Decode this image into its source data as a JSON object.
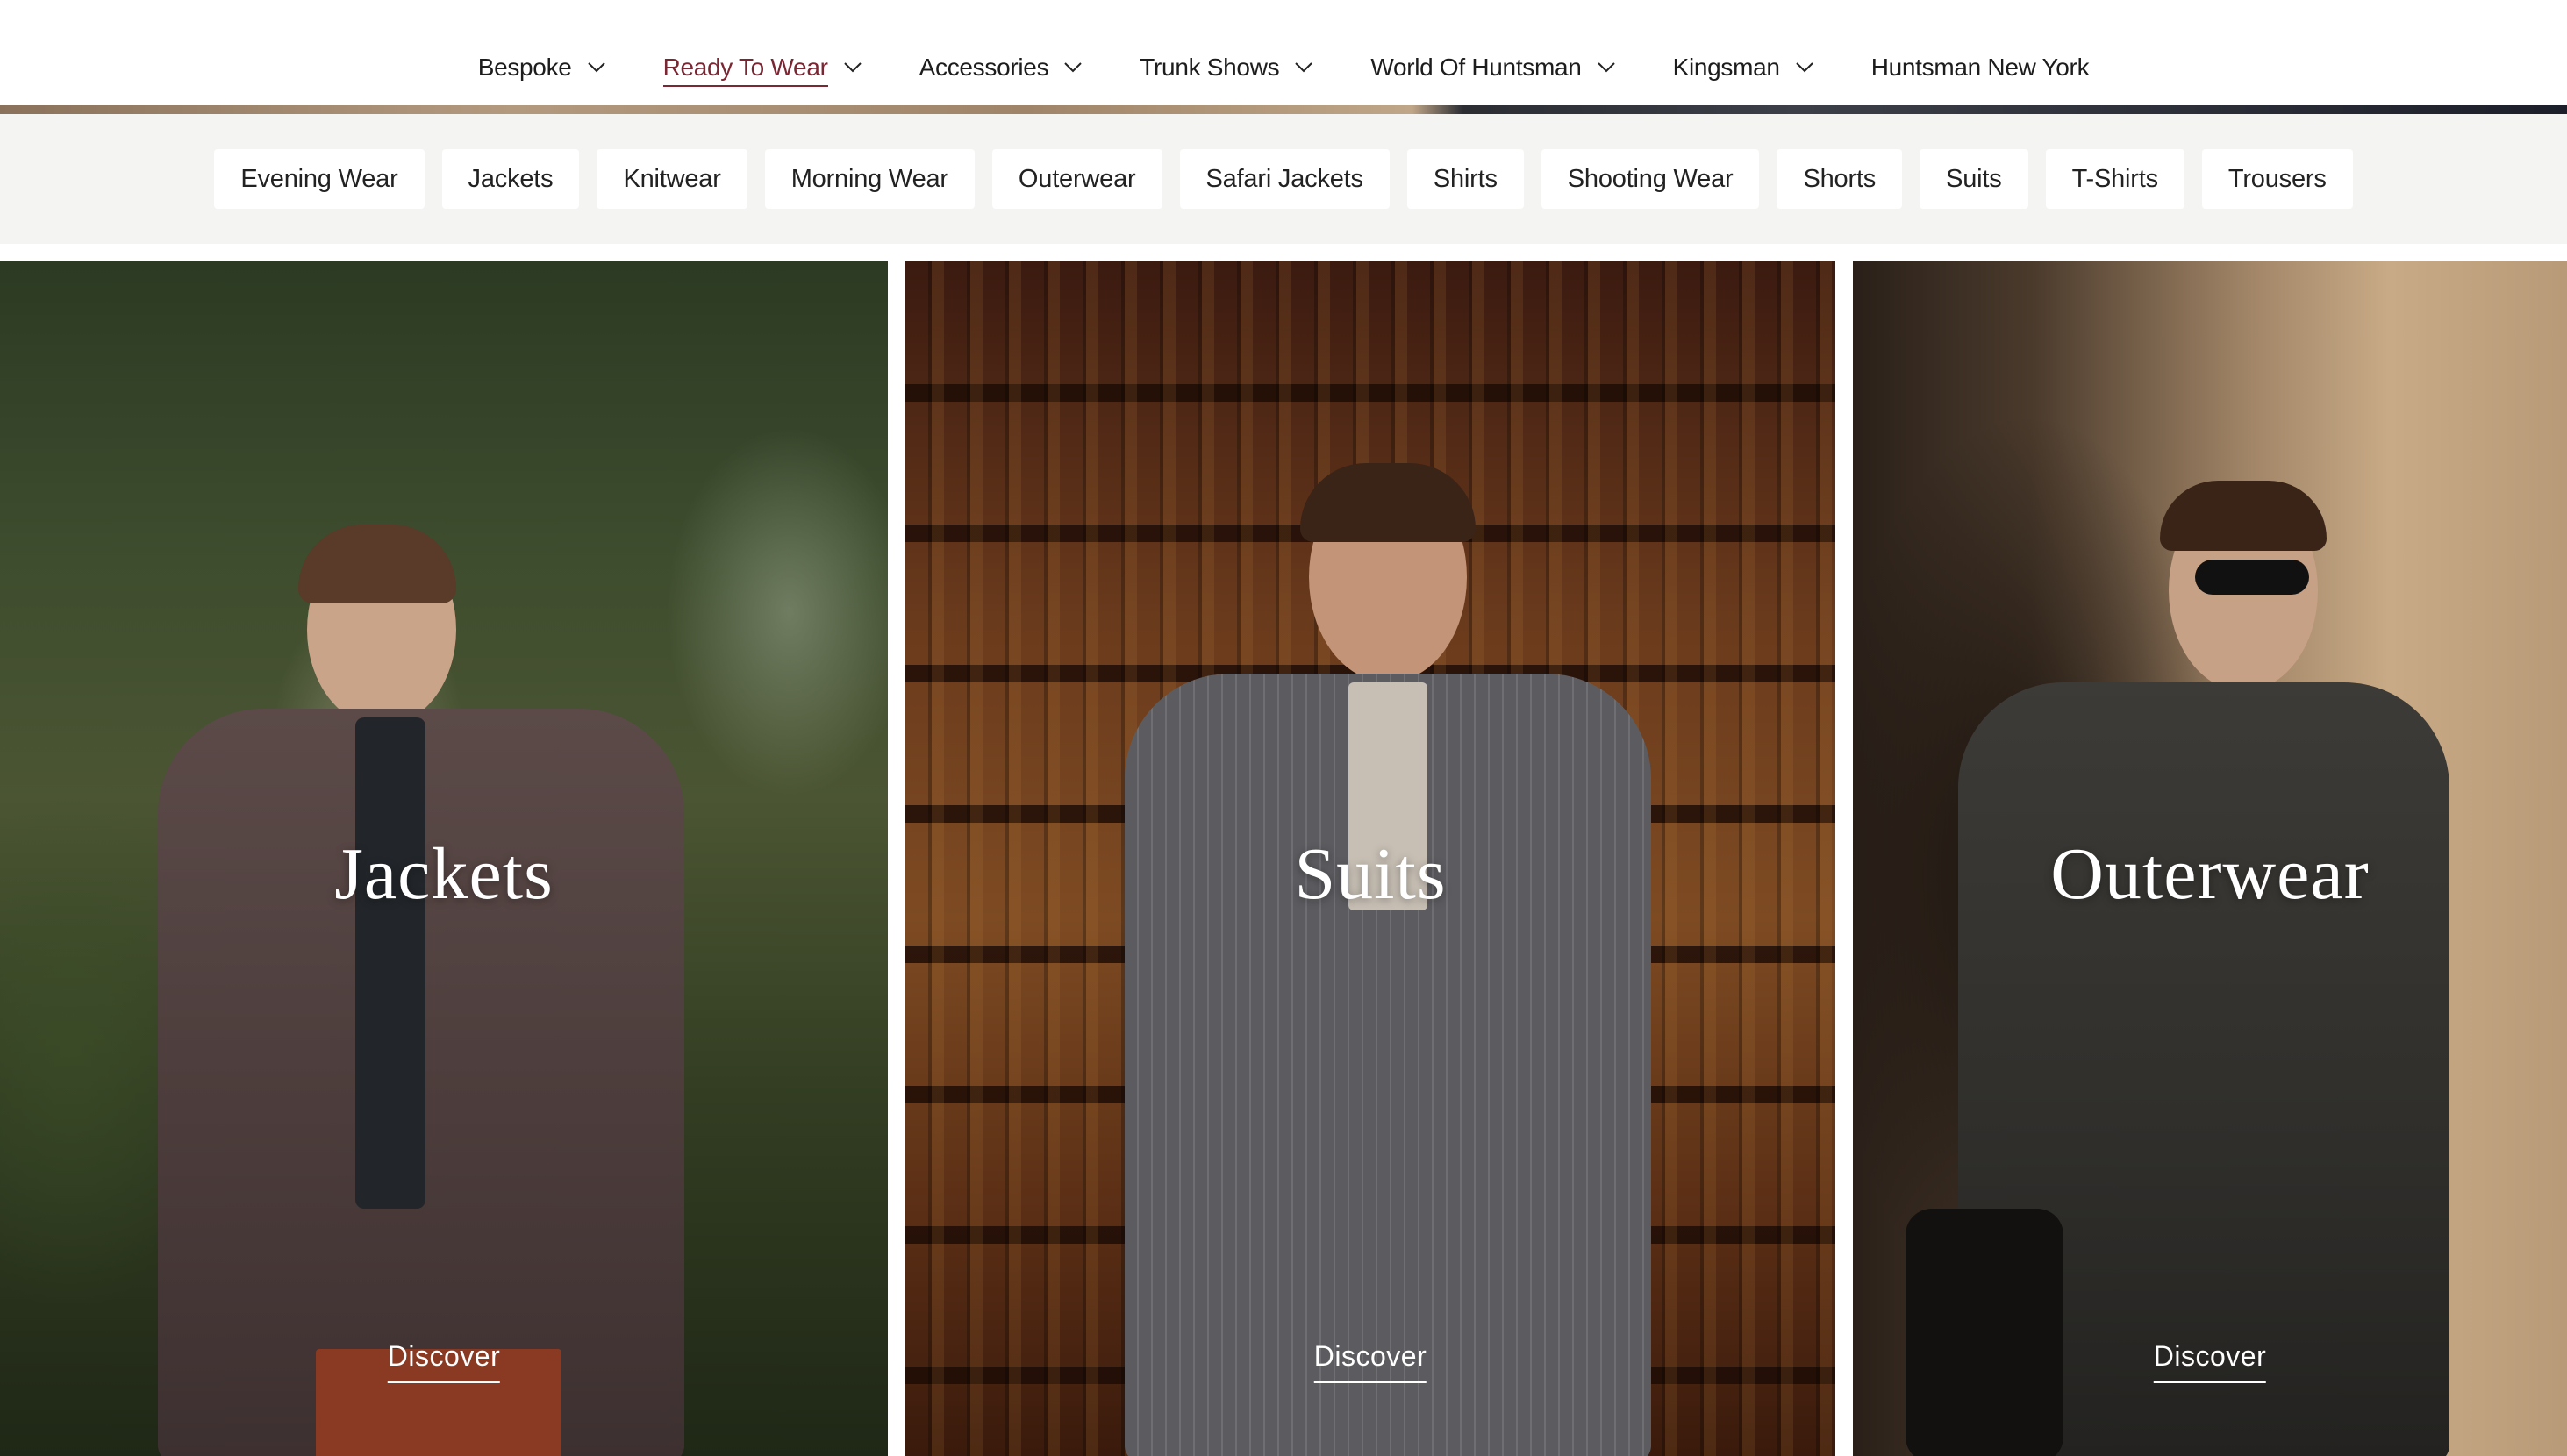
{
  "nav": {
    "items": [
      {
        "label": "Bespoke",
        "has_dropdown": true,
        "active": false
      },
      {
        "label": "Ready To Wear",
        "has_dropdown": true,
        "active": true
      },
      {
        "label": "Accessories",
        "has_dropdown": true,
        "active": false
      },
      {
        "label": "Trunk Shows",
        "has_dropdown": true,
        "active": false
      },
      {
        "label": "World Of Huntsman",
        "has_dropdown": true,
        "active": false
      },
      {
        "label": "Kingsman",
        "has_dropdown": true,
        "active": false
      },
      {
        "label": "Huntsman New York",
        "has_dropdown": false,
        "active": false
      }
    ],
    "active_color": "#7a2633"
  },
  "categories": [
    "Evening Wear",
    "Jackets",
    "Knitwear",
    "Morning Wear",
    "Outerwear",
    "Safari Jackets",
    "Shirts",
    "Shooting Wear",
    "Shorts",
    "Suits",
    "T-Shirts",
    "Trousers"
  ],
  "tiles": [
    {
      "title": "Jackets",
      "cta": "Discover"
    },
    {
      "title": "Suits",
      "cta": "Discover"
    },
    {
      "title": "Outerwear",
      "cta": "Discover"
    }
  ]
}
